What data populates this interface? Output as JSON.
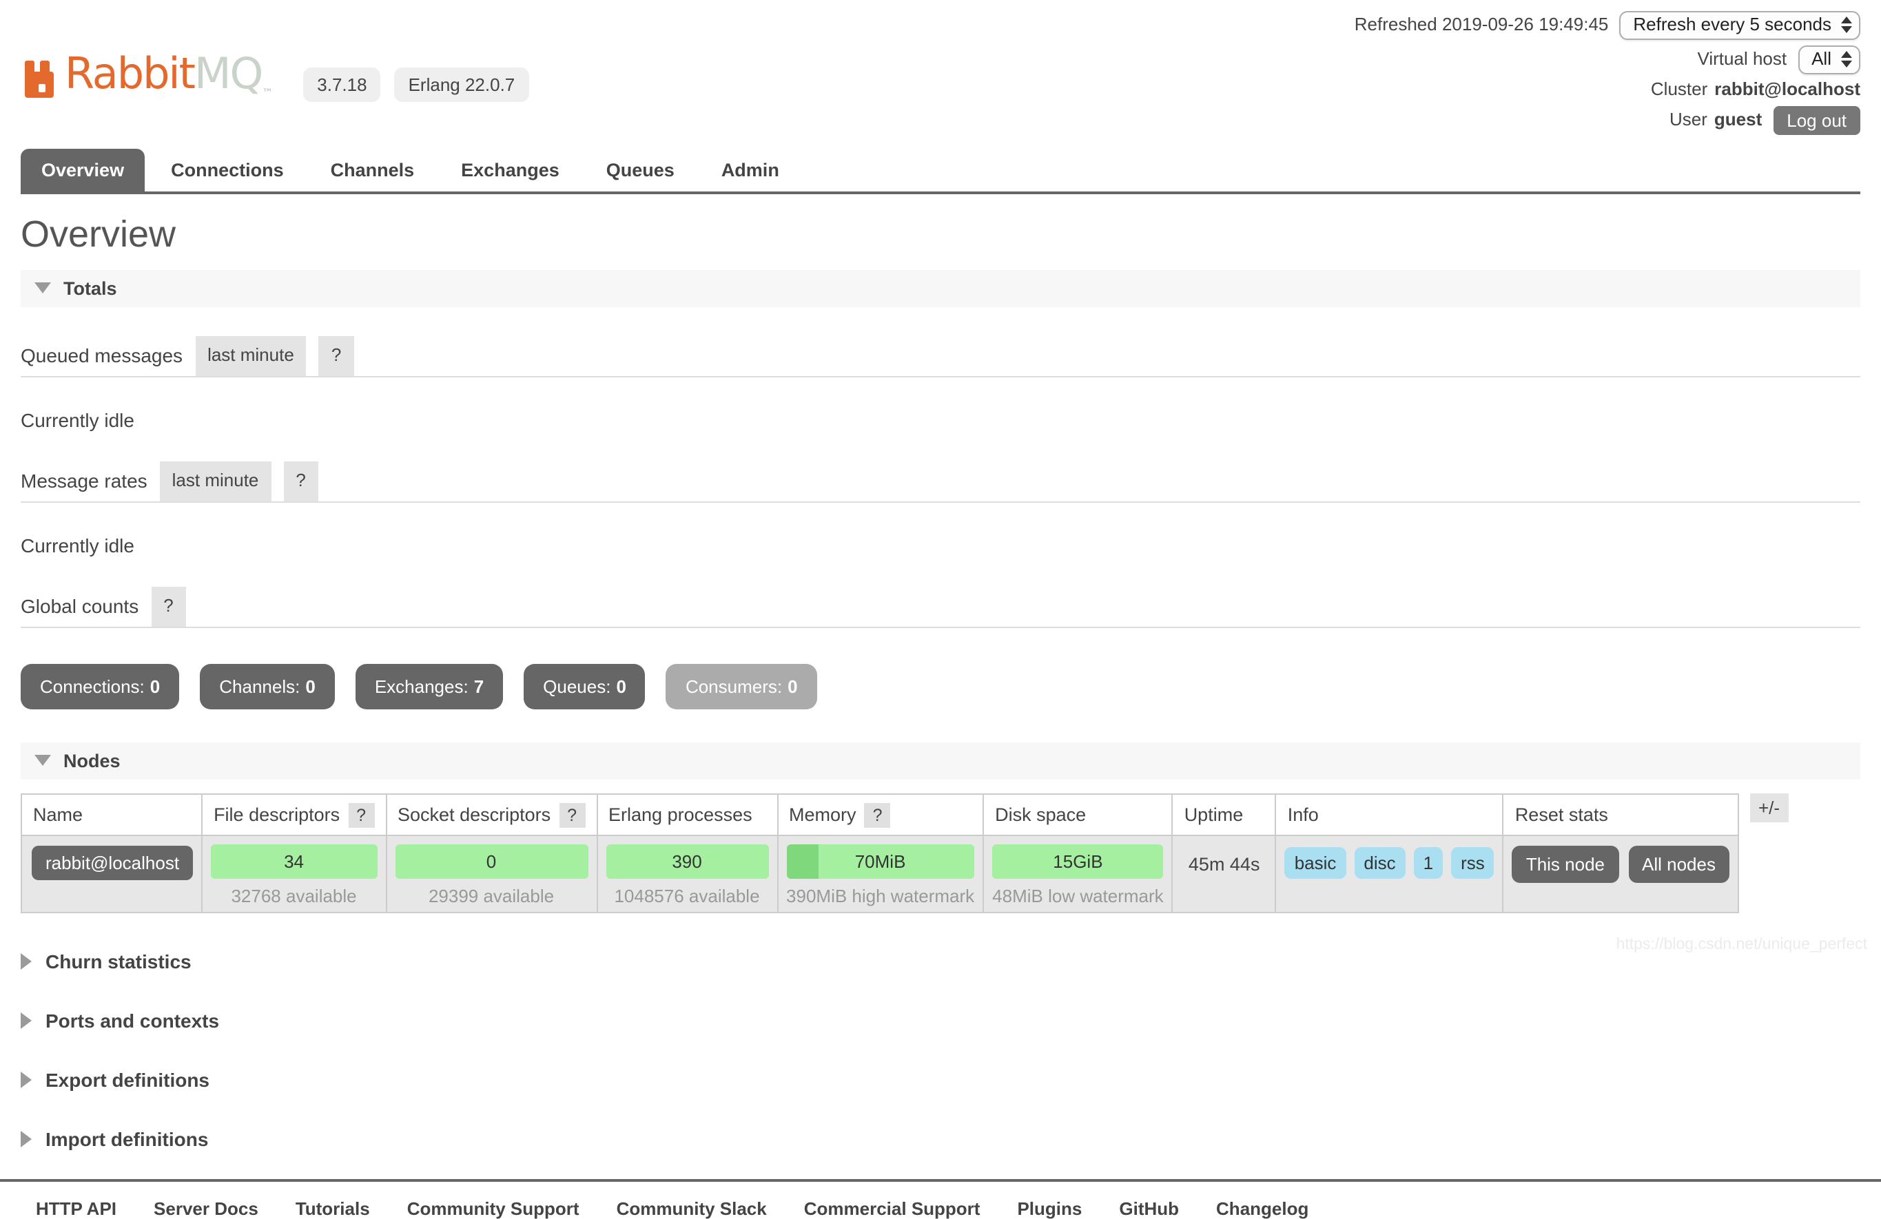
{
  "colors": {
    "brand-orange": "#e4692d",
    "brand-gray": "#c9d3c9",
    "btn-dark": "#666666",
    "btn-muted": "#ababab",
    "bar-green": "#a4f0a0",
    "bar-green-dark": "#7fd87c",
    "badge-blue": "#aadff2",
    "section-bg": "#f7f7f7",
    "row-bg": "#e7e7e7"
  },
  "header": {
    "brand_rabbit": "Rabbit",
    "brand_mq": "MQ",
    "brand_tm": "™",
    "version_badge": "3.7.18",
    "erlang_badge": "Erlang 22.0.7",
    "refreshed_label": "Refreshed",
    "refreshed_time": "2019-09-26 19:49:45",
    "refresh_select_value": "Refresh every 5 seconds",
    "virtual_host_label": "Virtual host",
    "virtual_host_value": "All",
    "cluster_label": "Cluster",
    "cluster_name": "rabbit@localhost",
    "user_label": "User",
    "user_name": "guest",
    "logout_label": "Log out"
  },
  "tabs": [
    {
      "label": "Overview",
      "active": true
    },
    {
      "label": "Connections",
      "active": false
    },
    {
      "label": "Channels",
      "active": false
    },
    {
      "label": "Exchanges",
      "active": false
    },
    {
      "label": "Queues",
      "active": false
    },
    {
      "label": "Admin",
      "active": false
    }
  ],
  "page_title": "Overview",
  "totals": {
    "section_label": "Totals",
    "queued_messages_label": "Queued messages",
    "queued_window": "last minute",
    "queued_help": "?",
    "queued_idle": "Currently idle",
    "message_rates_label": "Message rates",
    "rates_window": "last minute",
    "rates_help": "?",
    "rates_idle": "Currently idle",
    "global_counts_label": "Global counts",
    "global_help": "?",
    "count_buttons": [
      {
        "label": "Connections:",
        "value": "0",
        "muted": false
      },
      {
        "label": "Channels:",
        "value": "0",
        "muted": false
      },
      {
        "label": "Exchanges:",
        "value": "7",
        "muted": false
      },
      {
        "label": "Queues:",
        "value": "0",
        "muted": false
      },
      {
        "label": "Consumers:",
        "value": "0",
        "muted": true
      }
    ]
  },
  "nodes": {
    "section_label": "Nodes",
    "expander_label": "+/-",
    "columns": [
      {
        "label": "Name",
        "help": ""
      },
      {
        "label": "File descriptors",
        "help": "?"
      },
      {
        "label": "Socket descriptors",
        "help": "?"
      },
      {
        "label": "Erlang processes",
        "help": ""
      },
      {
        "label": "Memory",
        "help": "?"
      },
      {
        "label": "Disk space",
        "help": ""
      },
      {
        "label": "Uptime",
        "help": ""
      },
      {
        "label": "Info",
        "help": ""
      },
      {
        "label": "Reset stats",
        "help": ""
      }
    ],
    "row": {
      "name": "rabbit@localhost",
      "file_descriptors": {
        "used": "34",
        "available": "32768 available"
      },
      "socket_descriptors": {
        "used": "0",
        "available": "29399 available"
      },
      "erlang_processes": {
        "used": "390",
        "available": "1048576 available"
      },
      "memory": {
        "used": "70MiB",
        "detail": "390MiB high watermark"
      },
      "disk_space": {
        "used": "15GiB",
        "detail": "48MiB low watermark"
      },
      "uptime": "45m 44s",
      "info_badges": [
        "basic",
        "disc",
        "1",
        "rss"
      ],
      "reset_buttons": [
        "This node",
        "All nodes"
      ]
    }
  },
  "sections": [
    {
      "label": "Churn statistics"
    },
    {
      "label": "Ports and contexts"
    },
    {
      "label": "Export definitions"
    },
    {
      "label": "Import definitions"
    }
  ],
  "footer": {
    "links": [
      "HTTP API",
      "Server Docs",
      "Tutorials",
      "Community Support",
      "Community Slack",
      "Commercial Support",
      "Plugins",
      "GitHub",
      "Changelog"
    ]
  },
  "watermark": "https://blog.csdn.net/unique_perfect"
}
